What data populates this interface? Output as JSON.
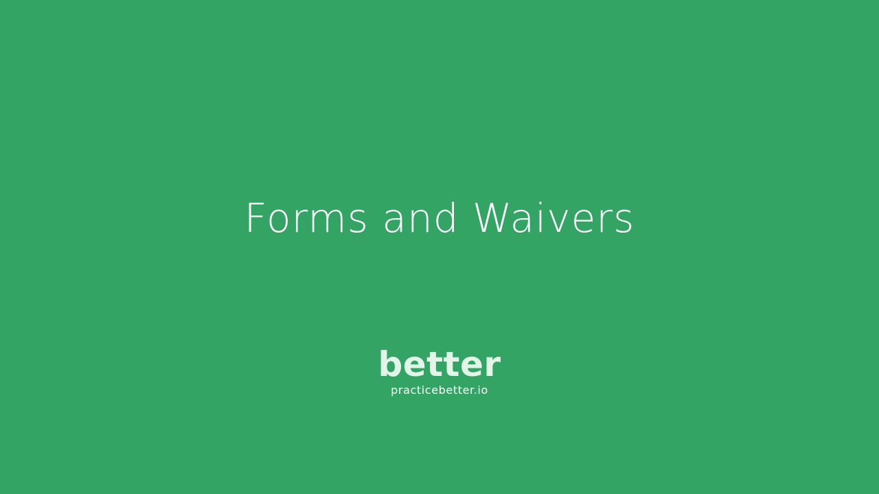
{
  "slide": {
    "title": "Forms and Waivers"
  },
  "brand": {
    "logo_text": "better",
    "url": "practicebetter.io"
  },
  "colors": {
    "background": "#34a465",
    "title_text": "#ffffff",
    "logo_text": "#e3f5e9"
  }
}
